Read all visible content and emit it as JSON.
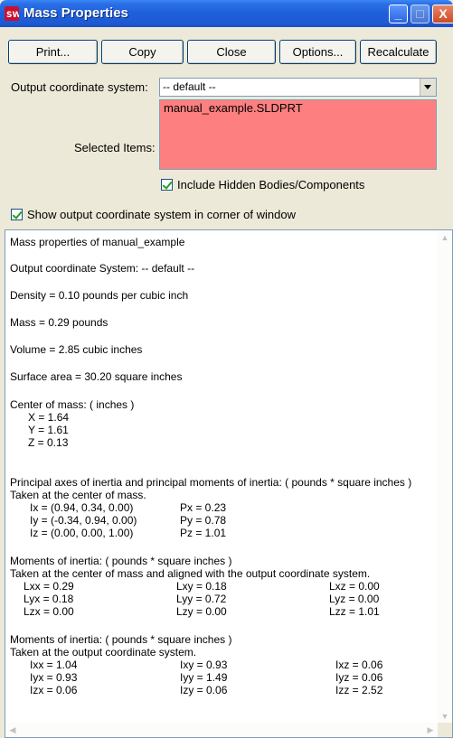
{
  "window": {
    "title": "Mass Properties",
    "app_icon": "solidworks-icon",
    "controls": {
      "minimize": "_",
      "maximize": "□",
      "close": "X"
    }
  },
  "toolbar": {
    "print": "Print...",
    "copy": "Copy",
    "close": "Close",
    "options": "Options...",
    "recalculate": "Recalculate"
  },
  "output_coord": {
    "label": "Output coordinate system:",
    "value": "-- default --"
  },
  "selected_items": {
    "label": "Selected Items:",
    "items": [
      "manual_example.SLDPRT"
    ],
    "highlight_color": "#fe7f7f"
  },
  "options": {
    "include_hidden": "Include Hidden Bodies/Components",
    "include_hidden_checked": true,
    "show_coord": "Show output coordinate system in corner of window",
    "show_coord_checked": true
  },
  "report": {
    "title": "Mass properties of manual_example",
    "output_coord": "Output  coordinate System: -- default --",
    "density": "Density = 0.10 pounds per cubic inch",
    "mass": "Mass = 0.29 pounds",
    "volume": "Volume = 2.85 cubic inches",
    "surface_area": "Surface area = 30.20 square inches",
    "com_header": "Center of mass: ( inches )",
    "com_x": "X = 1.64",
    "com_y": "Y = 1.61",
    "com_z": "Z = 0.13",
    "principal_header": "Principal axes of inertia and principal moments of inertia: ( pounds * square inches )",
    "principal_sub": "Taken at the center of mass.",
    "ix": "Ix = (0.94, 0.34, 0.00)",
    "iy": "Iy = (-0.34, 0.94, 0.00)",
    "iz": "Iz = (0.00, 0.00, 1.00)",
    "px": "Px = 0.23",
    "py": "Py = 0.78",
    "pz": "Pz = 1.01",
    "moi_com_header": "Moments of inertia: ( pounds * square inches )",
    "moi_com_sub": "Taken at the center of mass and aligned with the output coordinate system.",
    "lxx": "Lxx = 0.29",
    "lxy": "Lxy = 0.18",
    "lxz": "Lxz = 0.00",
    "lyx": "Lyx = 0.18",
    "lyy": "Lyy = 0.72",
    "lyz": "Lyz = 0.00",
    "lzx": "Lzx = 0.00",
    "lzy": "Lzy = 0.00",
    "lzz": "Lzz = 1.01",
    "moi_out_header": "Moments of inertia: ( pounds * square inches )",
    "moi_out_sub": "Taken at the output coordinate system.",
    "ixx": "Ixx = 1.04",
    "ixy": "Ixy = 0.93",
    "ixz": "Ixz = 0.06",
    "iyx": "Iyx = 0.93",
    "iyy": "Iyy = 1.49",
    "iyz": "Iyz = 0.06",
    "izx": "Izx = 0.06",
    "izy": "Izy = 0.06",
    "izz": "Izz = 2.52"
  }
}
